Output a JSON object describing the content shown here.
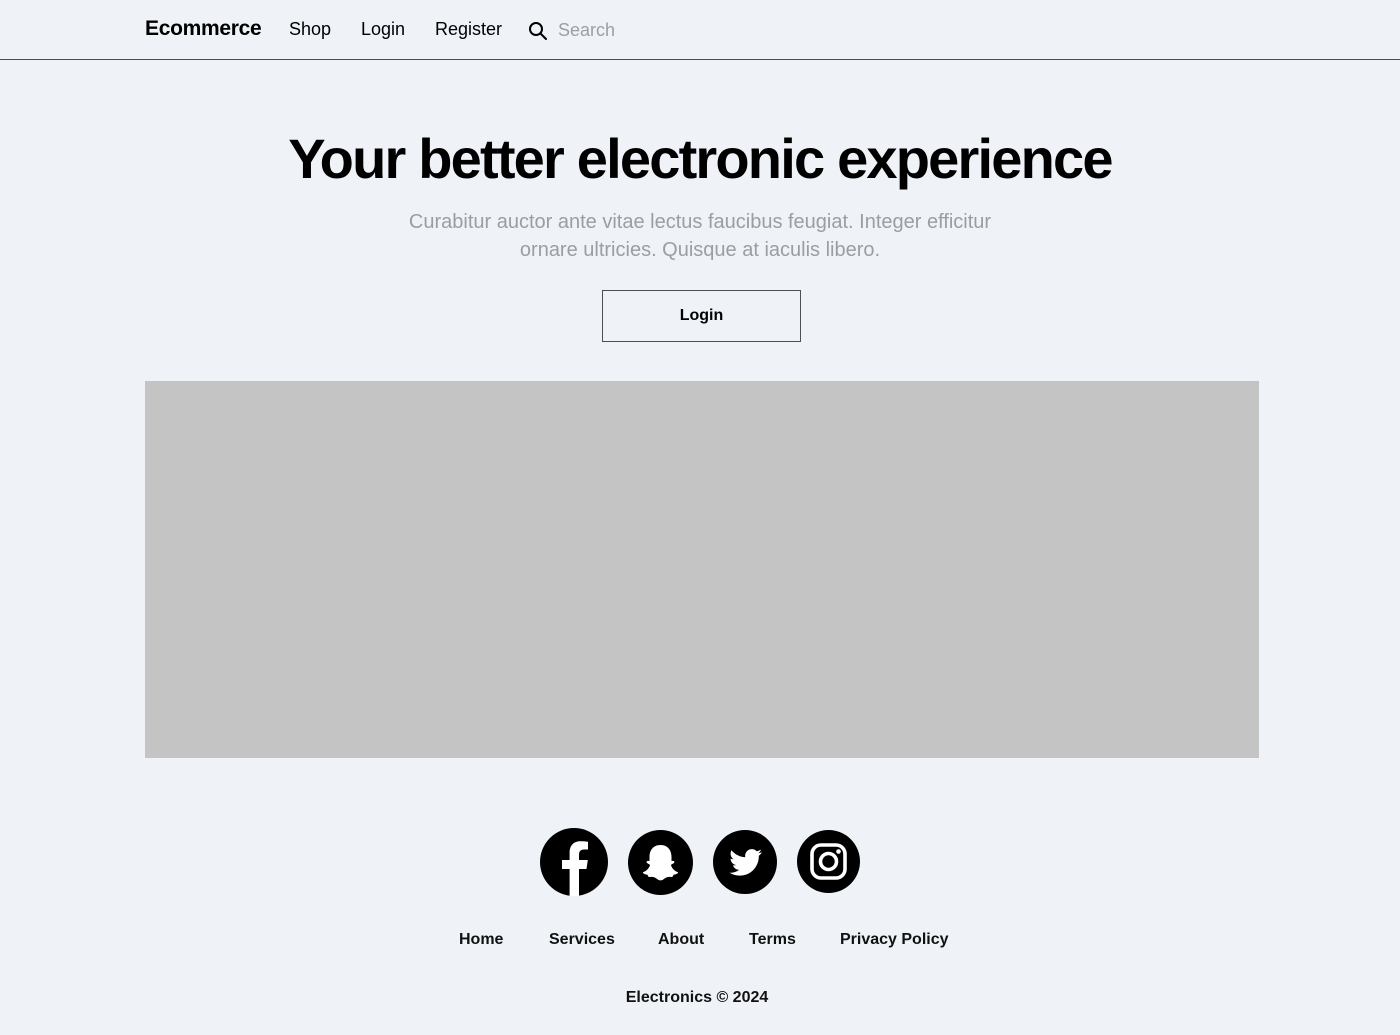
{
  "navbar": {
    "brand": "Ecommerce",
    "links": [
      "Shop",
      "Login",
      "Register"
    ],
    "search": {
      "icon": "search-icon",
      "placeholder": "Search"
    }
  },
  "hero": {
    "title": "Your better electronic experience",
    "subtitle": "Curabitur auctor ante vitae lectus faucibus feugiat. Integer efficitur ornare ultricies. Quisque at iaculis libero.",
    "button_label": "Login"
  },
  "footer": {
    "social_icons": [
      "facebook-icon",
      "snapchat-icon",
      "twitter-icon",
      "instagram-icon"
    ],
    "links": [
      "Home",
      "Services",
      "About",
      "Terms",
      "Privacy Policy"
    ],
    "copyright": "Electronics © 2024"
  },
  "colors": {
    "background": "#eff3f8",
    "image_placeholder": "#c4c4c4",
    "muted_text": "#9a9ea3",
    "border": "#4b5055"
  }
}
